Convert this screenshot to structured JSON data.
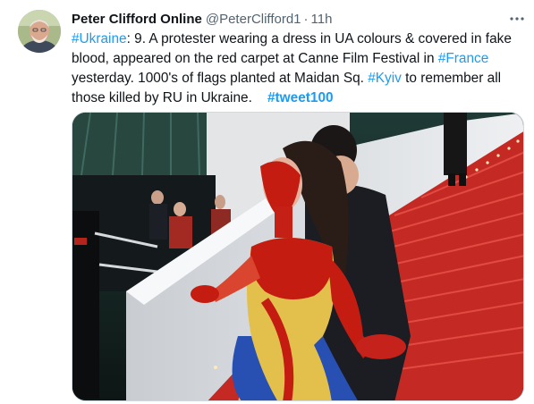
{
  "tweet": {
    "author": {
      "display_name": "Peter Clifford Online",
      "handle": "@PeterClifford1",
      "separator": "·",
      "time": "11h"
    },
    "more_icon": "ellipsis-horizontal-icon",
    "text_lines": [
      [
        {
          "t": "#Ukraine",
          "link": true
        },
        {
          "t": ": 9. A protester wearing a dress in UA colours & covered in fake"
        }
      ],
      [
        {
          "t": "blood, appeared on the red carpet at Canne Film Festival in "
        },
        {
          "t": "#France",
          "link": true
        }
      ],
      [
        {
          "t": "yesterday. 1000's of flags planted at Maidan Sq. "
        },
        {
          "t": "#Kyiv",
          "link": true
        },
        {
          "t": " to remember all"
        }
      ],
      [
        {
          "t": "those killed by RU in Ukraine.    "
        },
        {
          "t": "#tweet100",
          "link": true,
          "bold": true
        }
      ]
    ],
    "media": {
      "kind": "photo",
      "colors": {
        "carpet": "#d22a22",
        "blood": "#c51c12",
        "dress_blue": "#2a4fb0",
        "dress_yellow": "#e8c84a",
        "skin": "#e9b8a0"
      }
    }
  },
  "colors": {
    "accent": "#1d9bf0",
    "text": "#0f1419",
    "secondary": "#536471",
    "border": "#cfd9de"
  }
}
